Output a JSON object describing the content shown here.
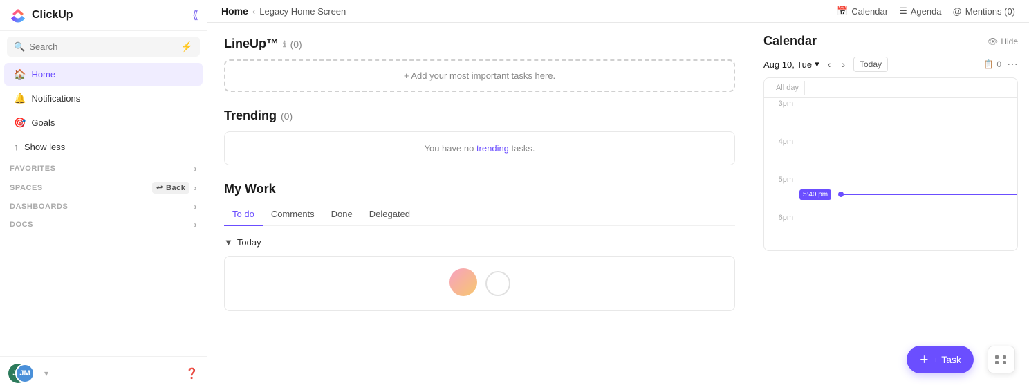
{
  "app": {
    "name": "ClickUp"
  },
  "sidebar": {
    "search_placeholder": "Search",
    "nav_items": [
      {
        "id": "home",
        "label": "Home",
        "active": true
      },
      {
        "id": "notifications",
        "label": "Notifications",
        "active": false
      },
      {
        "id": "goals",
        "label": "Goals",
        "active": false
      },
      {
        "id": "show_less",
        "label": "Show less",
        "active": false
      }
    ],
    "sections": [
      {
        "id": "favorites",
        "label": "FAVORITES"
      },
      {
        "id": "spaces",
        "label": "SPACES",
        "back": "Back"
      },
      {
        "id": "dashboards",
        "label": "DASHBOARDS"
      },
      {
        "id": "docs",
        "label": "DOCS"
      }
    ],
    "avatar_initials": "JM",
    "avatar_second": "JM"
  },
  "header": {
    "home_label": "Home",
    "breadcrumb_sep": "‹",
    "legacy_label": "Legacy Home Screen",
    "calendar_label": "Calendar",
    "agenda_label": "Agenda",
    "mentions_label": "Mentions (0)"
  },
  "lineup": {
    "title": "LineUp™",
    "badge": "(0)",
    "add_label": "+ Add your most important tasks here."
  },
  "trending": {
    "title": "Trending",
    "badge": "(0)",
    "empty_text": "You have no trending tasks."
  },
  "my_work": {
    "title": "My Work",
    "tabs": [
      "To do",
      "Comments",
      "Done",
      "Delegated"
    ],
    "active_tab": 0,
    "today_label": "Today"
  },
  "calendar": {
    "title": "Calendar",
    "hide_label": "Hide",
    "date_label": "Aug 10, Tue",
    "today_label": "Today",
    "count": "0",
    "time_slots": [
      {
        "time": "3pm"
      },
      {
        "time": "4pm"
      },
      {
        "time": "5pm"
      },
      {
        "time": "6pm"
      }
    ],
    "current_time": "5:40 pm"
  },
  "footer": {
    "task_label": "+ Task"
  }
}
